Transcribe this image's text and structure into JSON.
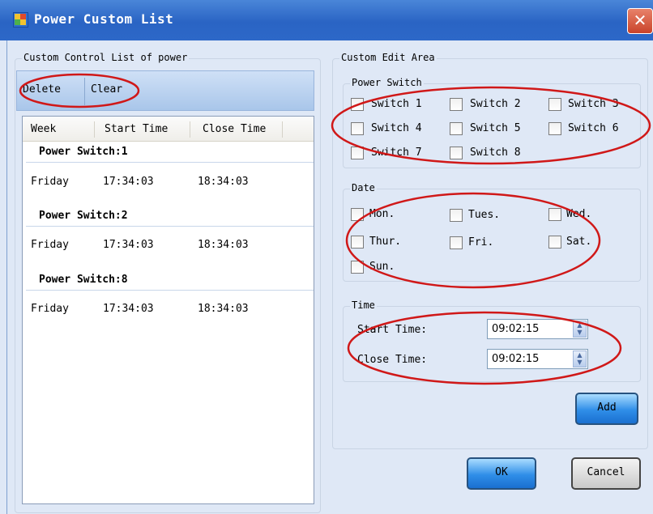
{
  "window": {
    "title": "Power Custom List",
    "close_icon": "close-icon"
  },
  "list_panel": {
    "legend": "Custom Control List of power",
    "toolbar": {
      "delete_label": "Delete",
      "clear_label": "Clear"
    },
    "columns": [
      "Week",
      "Start Time",
      "Close Time"
    ],
    "groups": [
      {
        "header": "Power Switch:1",
        "rows": [
          {
            "week": "Friday",
            "start": "17:34:03",
            "close": "18:34:03"
          }
        ]
      },
      {
        "header": "Power Switch:2",
        "rows": [
          {
            "week": "Friday",
            "start": "17:34:03",
            "close": "18:34:03"
          }
        ]
      },
      {
        "header": "Power Switch:8",
        "rows": [
          {
            "week": "Friday",
            "start": "17:34:03",
            "close": "18:34:03"
          }
        ]
      }
    ]
  },
  "edit_area": {
    "legend": "Custom Edit Area",
    "power_switch": {
      "legend": "Power Switch",
      "items": [
        {
          "label": "Switch 1",
          "checked": false
        },
        {
          "label": "Switch 2",
          "checked": false
        },
        {
          "label": "Switch 3",
          "checked": false
        },
        {
          "label": "Switch 4",
          "checked": false
        },
        {
          "label": "Switch 5",
          "checked": false
        },
        {
          "label": "Switch 6",
          "checked": false
        },
        {
          "label": "Switch 7",
          "checked": false
        },
        {
          "label": "Switch 8",
          "checked": false
        }
      ]
    },
    "date": {
      "legend": "Date",
      "items": [
        {
          "label": "Mon.",
          "checked": false
        },
        {
          "label": "Tues.",
          "checked": false
        },
        {
          "label": "Wed.",
          "checked": false
        },
        {
          "label": "Thur.",
          "checked": false
        },
        {
          "label": "Fri.",
          "checked": false
        },
        {
          "label": "Sat.",
          "checked": false
        },
        {
          "label": "Sun.",
          "checked": false
        }
      ]
    },
    "time": {
      "legend": "Time",
      "start_label": "Start Time:",
      "start_value": "09:02:15",
      "close_label": "Close Time:",
      "close_value": "09:02:15"
    },
    "add_label": "Add"
  },
  "footer": {
    "ok_label": "OK",
    "cancel_label": "Cancel"
  },
  "colors": {
    "title_bar": "#2a64c4",
    "annotation_red": "#d01818",
    "button_blue": "#2f8ee8"
  }
}
